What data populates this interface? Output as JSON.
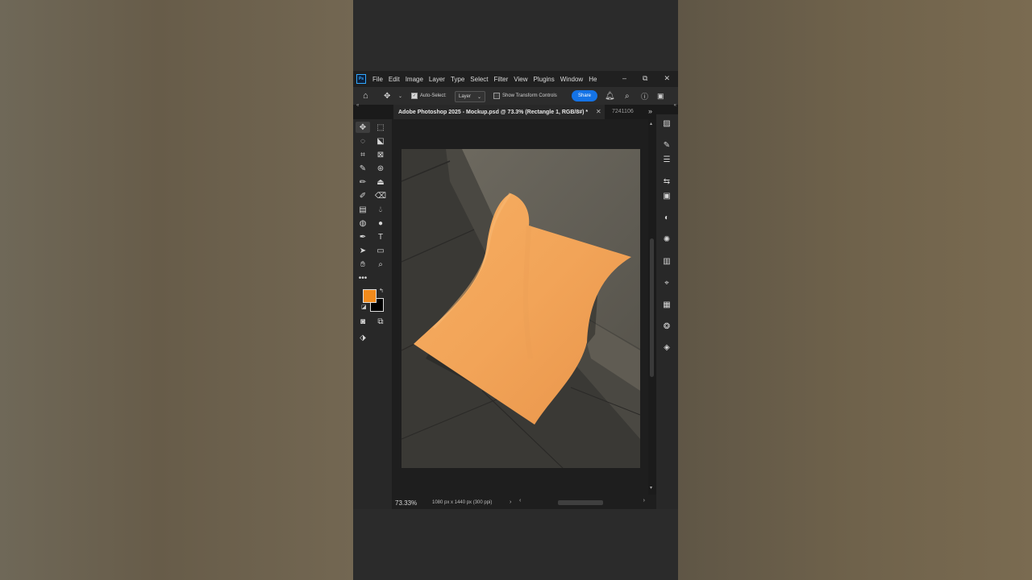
{
  "menu": {
    "app_icon": "Ps",
    "items": [
      "File",
      "Edit",
      "Image",
      "Layer",
      "Type",
      "Select",
      "Filter",
      "View",
      "Plugins",
      "Window",
      "He"
    ],
    "window_controls": [
      "–",
      "⧉",
      "✕"
    ]
  },
  "options_bar": {
    "auto_select_label": "Auto-Select:",
    "layer_value": "Layer",
    "show_transform_label": "Show Transform Controls",
    "share_label": "Share"
  },
  "tabs": {
    "active_title": "Adobe Photoshop 2025 - Mockup.psd @ 73.3% (Rectangle 1, RGB/8#) *",
    "second_title": "7241106"
  },
  "status": {
    "zoom": "73.33%",
    "doc_size": "1080 px x 1440 px (300 ppi)"
  },
  "colors": {
    "foreground": "#f08a1c",
    "background": "#000000",
    "accent": "#1473e6"
  },
  "tools_icons": [
    "move-icon",
    "marquee-icon",
    "lasso-icon",
    "object-select-icon",
    "crop-icon",
    "frame-icon",
    "eyedropper-icon",
    "spot-heal-icon",
    "brush-icon",
    "stamp-icon",
    "history-brush-icon",
    "eraser-icon",
    "gradient-icon",
    "blur-icon",
    "dodge-icon",
    "smudge-icon",
    "pen-icon",
    "type-icon",
    "path-select-icon",
    "rectangle-icon",
    "hand-icon",
    "zoom-icon",
    "more-tools-icon"
  ],
  "right_panel_icons": [
    "properties-icon",
    "brush-settings-icon",
    "adjust-icon",
    "history-icon",
    "libraries-icon",
    "adjustments-icon",
    "styles-icon",
    "gradients-icon",
    "paths-icon",
    "swatches-icon",
    "channels-icon",
    "layers-icon"
  ]
}
